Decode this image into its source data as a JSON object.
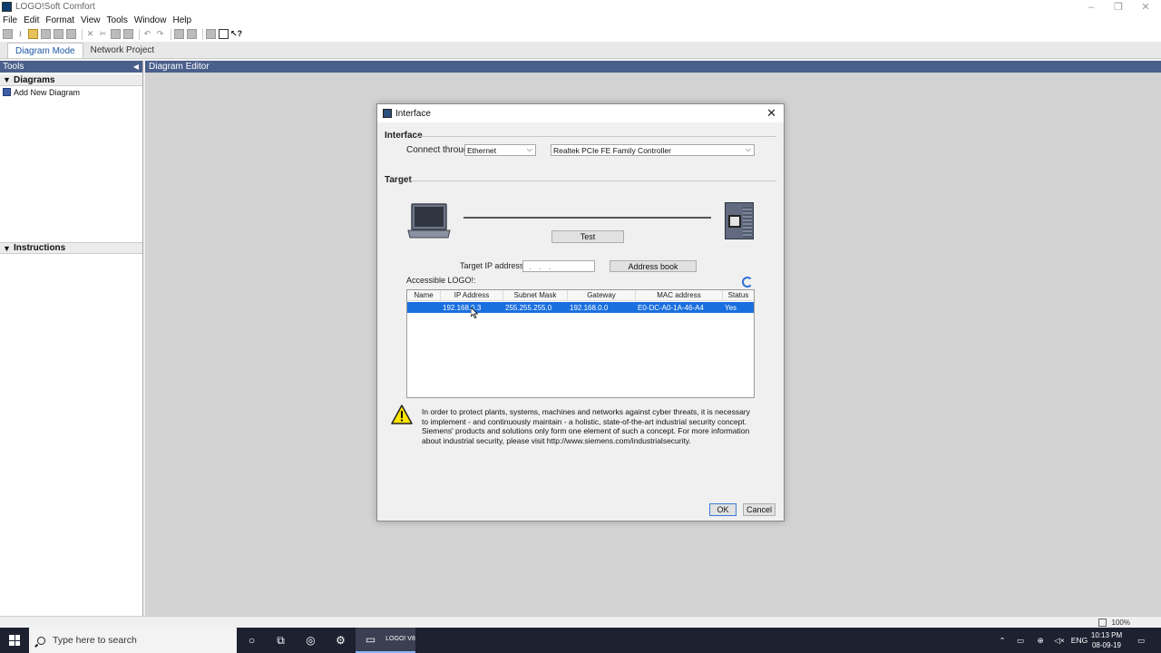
{
  "window": {
    "title": "LOGO!Soft Comfort",
    "controls": {
      "minimize": "–",
      "maximize": "❐",
      "close": "✕"
    }
  },
  "menu": [
    "File",
    "Edit",
    "Format",
    "View",
    "Tools",
    "Window",
    "Help"
  ],
  "mode_tabs": {
    "diagram_mode": "Diagram Mode",
    "network_project": "Network Project"
  },
  "tools_panel": {
    "title": "Tools",
    "diagrams_section": "Diagrams",
    "add_new_diagram": "Add New Diagram",
    "instructions_section": "Instructions"
  },
  "editor": {
    "title": "Diagram Editor"
  },
  "dialog": {
    "title": "Interface",
    "close": "✕",
    "interface_group": "Interface",
    "connect_through_label": "Connect through:",
    "connect_through_value": "Ethernet",
    "adapter_value": "Realtek PCIe FE Family Controller",
    "target_group": "Target",
    "test_button": "Test",
    "target_ip_label": "Target IP address:",
    "target_ip_value": ". . .",
    "address_book_button": "Address book",
    "accessible_label": "Accessible LOGO!:",
    "table": {
      "headers": [
        "Name",
        "IP Address",
        "Subnet Mask",
        "Gateway",
        "MAC address",
        "Status"
      ],
      "rows": [
        [
          "",
          "192.168.0.3",
          "255.255.255.0",
          "192.168.0.0",
          "E0-DC-A0-1A-46-A4",
          "Yes"
        ]
      ]
    },
    "warning_text": "In order to protect plants, systems, machines and networks against cyber threats, it is necessary to implement - and continuously maintain - a holistic, state-of-the-art industrial security concept. Siemens' products and solutions only form one element of such a concept. For more information about industrial security, please visit http://www.siemens.com/industrialsecurity.",
    "ok_button": "OK",
    "cancel_button": "Cancel"
  },
  "statusbar": {
    "zoom": "100%"
  },
  "taskbar": {
    "search_placeholder": "Type here to search",
    "app_badge": "LOGO! V8",
    "language": "ENG",
    "time": "10:13 PM",
    "date": "08-09-19"
  },
  "colors": {
    "selection": "#1a6fde",
    "panel_header": "#4a5f8c",
    "taskbar": "#1d2130"
  }
}
